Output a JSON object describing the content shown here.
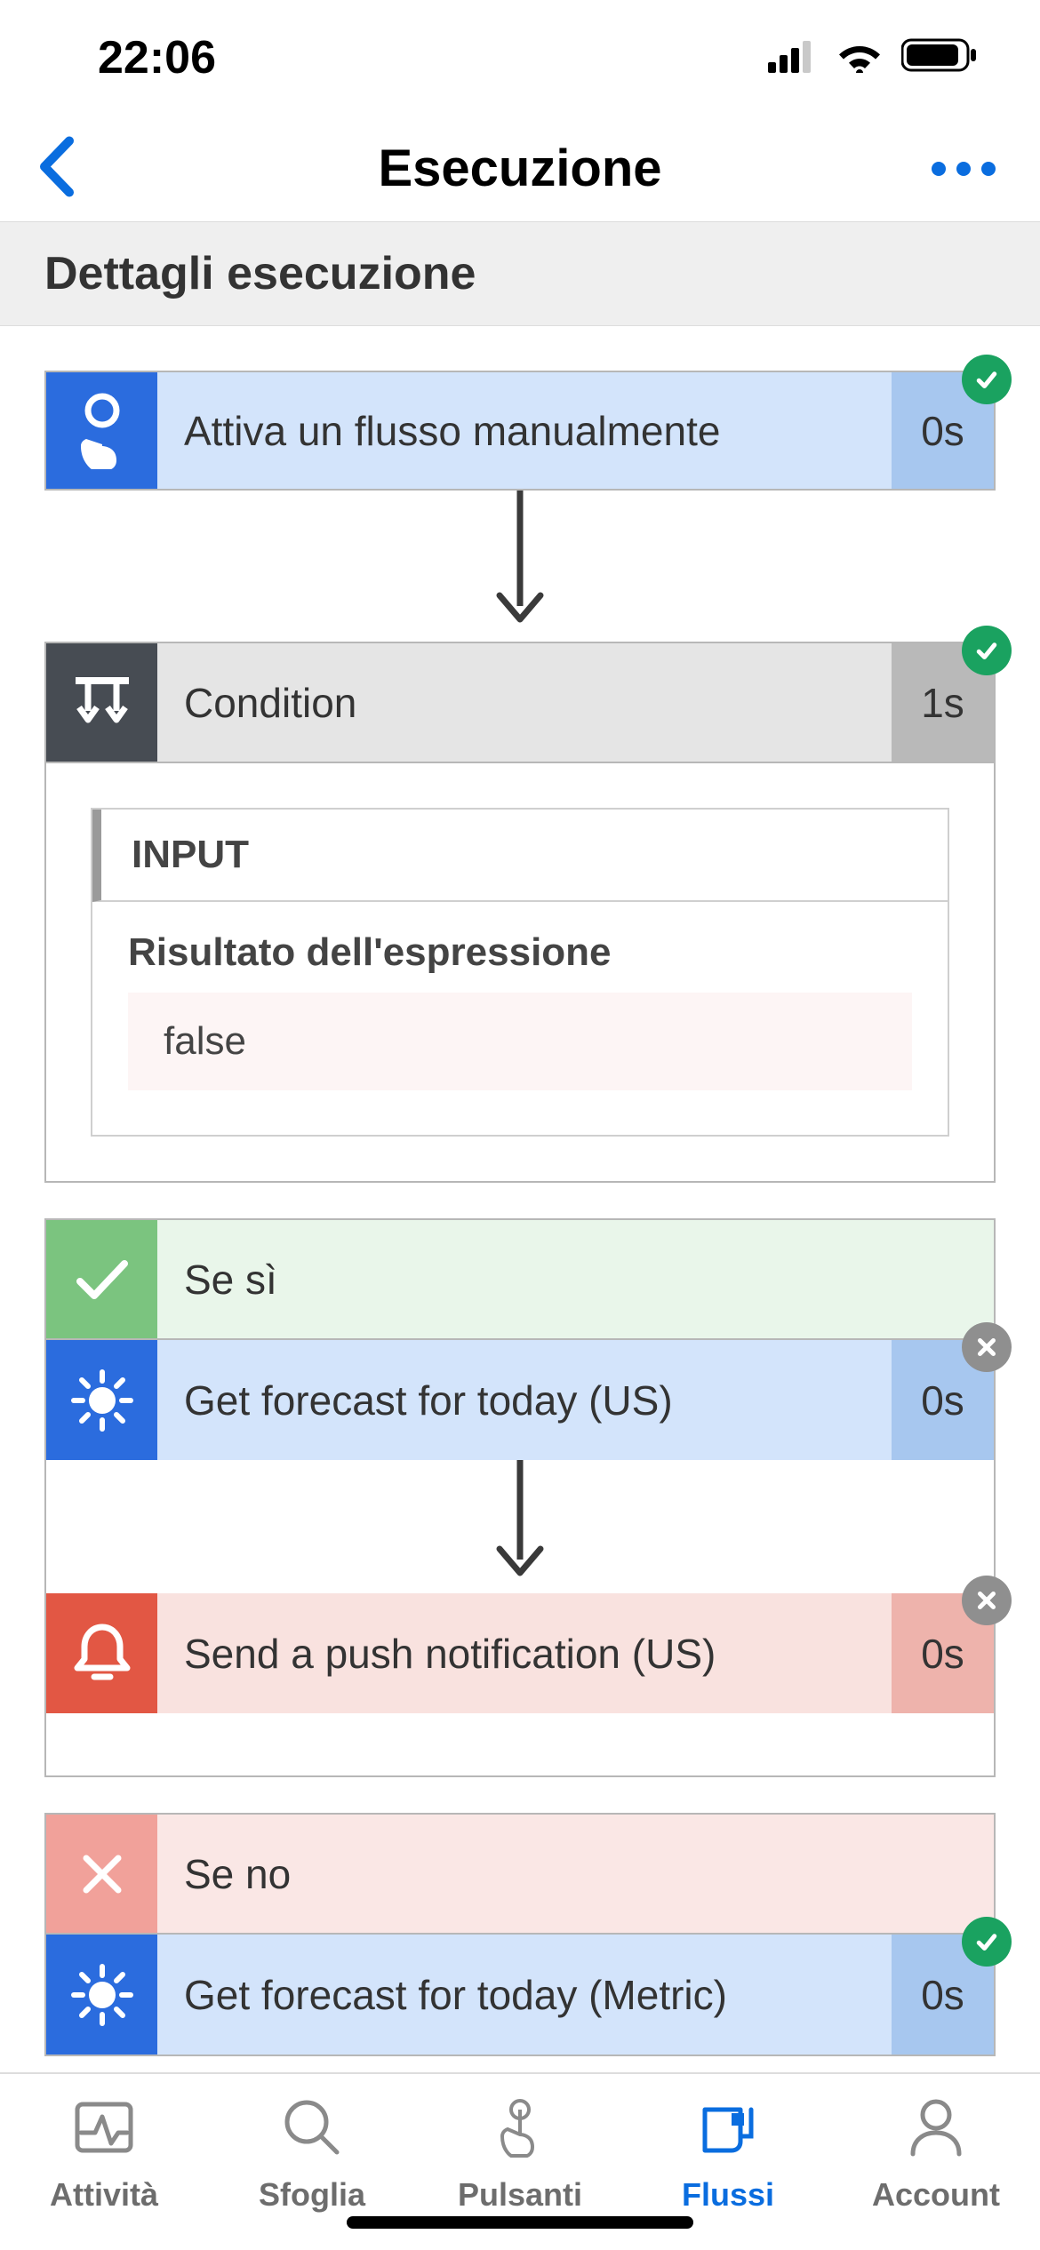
{
  "status_bar": {
    "time": "22:06"
  },
  "nav": {
    "title": "Esecuzione"
  },
  "section": {
    "title": "Dettagli esecuzione"
  },
  "steps": {
    "trigger": {
      "label": "Attiva un flusso manualmente",
      "time": "0s",
      "status": "success"
    },
    "condition": {
      "label": "Condition",
      "time": "1s",
      "status": "success",
      "input_header": "INPUT",
      "input_label": "Risultato dell'espressione",
      "input_value": "false"
    },
    "yes": {
      "label": "Se sì"
    },
    "forecast_us": {
      "label": "Get forecast for today (US)",
      "time": "0s",
      "status": "skipped"
    },
    "notif_us": {
      "label": "Send a push notification (US)",
      "time": "0s",
      "status": "skipped"
    },
    "no": {
      "label": "Se no"
    },
    "forecast_m": {
      "label": "Get forecast for today (Metric)",
      "time": "0s",
      "status": "success"
    }
  },
  "tabs": {
    "activity": "Attività",
    "browse": "Sfoglia",
    "buttons": "Pulsanti",
    "flows": "Flussi",
    "account": "Account"
  }
}
